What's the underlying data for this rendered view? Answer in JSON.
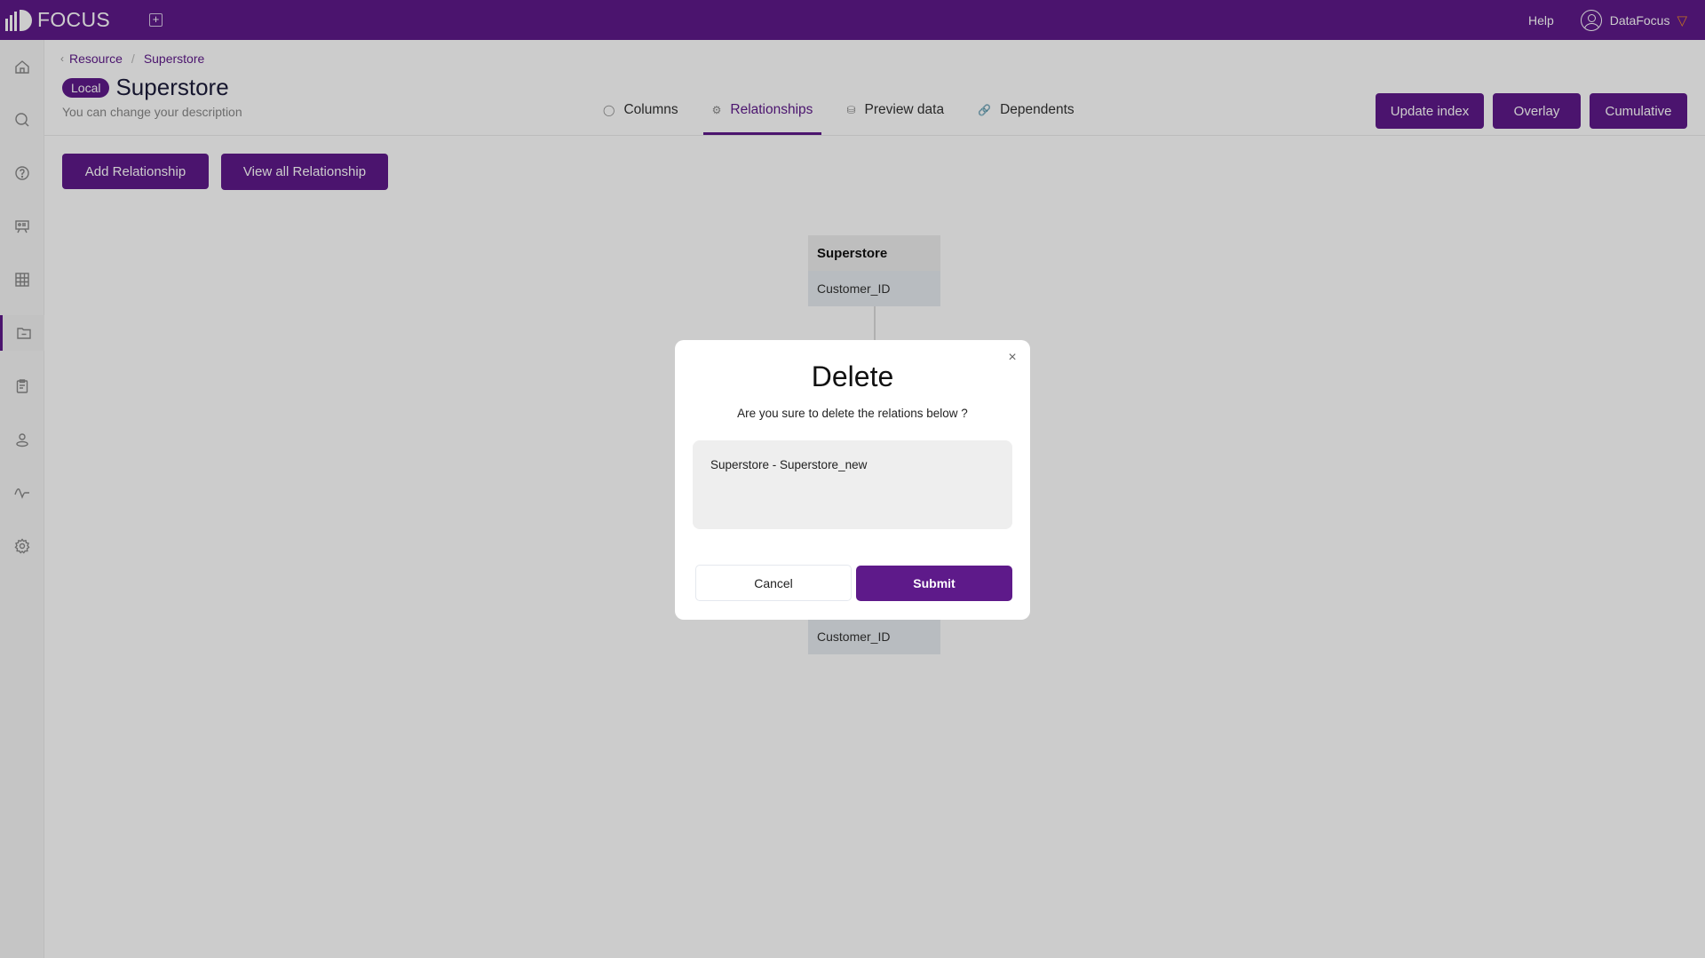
{
  "app": {
    "logo_text": "FOCUS",
    "help_label": "Help",
    "user_name": "DataFocus",
    "colors": {
      "brand": "#5e1a8a",
      "accent_gem": "#f08a2c"
    }
  },
  "sidebar": {
    "items": [
      {
        "name": "home",
        "icon": "home-icon",
        "active": false
      },
      {
        "name": "search",
        "icon": "search-icon",
        "active": false
      },
      {
        "name": "help",
        "icon": "question-icon",
        "active": false
      },
      {
        "name": "presentation",
        "icon": "presentation-icon",
        "active": false
      },
      {
        "name": "table",
        "icon": "grid-icon",
        "active": false
      },
      {
        "name": "resource",
        "icon": "folder-icon",
        "active": true
      },
      {
        "name": "tasks",
        "icon": "clipboard-icon",
        "active": false
      },
      {
        "name": "user",
        "icon": "user-icon",
        "active": false
      },
      {
        "name": "monitor",
        "icon": "pulse-icon",
        "active": false
      },
      {
        "name": "settings",
        "icon": "gear-icon",
        "active": false
      }
    ]
  },
  "breadcrumb": {
    "parent": "Resource",
    "current": "Superstore"
  },
  "header": {
    "badge": "Local",
    "title": "Superstore",
    "description": "You can change your description"
  },
  "tabs": [
    {
      "label": "Columns",
      "icon": "user-icon",
      "active": false
    },
    {
      "label": "Relationships",
      "icon": "gear-icon",
      "active": true
    },
    {
      "label": "Preview data",
      "icon": "database-icon",
      "active": false
    },
    {
      "label": "Dependents",
      "icon": "link-icon",
      "active": false
    }
  ],
  "actions": {
    "update_index": "Update index",
    "overlay": "Overlay",
    "cumulative": "Cumulative",
    "add_relationship": "Add Relationship",
    "view_all_relationship": "View all Relationship"
  },
  "diagram": {
    "top_table": {
      "name": "Superstore",
      "column": "Customer_ID"
    },
    "bottom_table": {
      "column": "Customer_ID"
    }
  },
  "modal": {
    "title": "Delete",
    "message": "Are you sure to delete the relations below ?",
    "relations": "Superstore - Superstore_new",
    "cancel": "Cancel",
    "submit": "Submit"
  }
}
